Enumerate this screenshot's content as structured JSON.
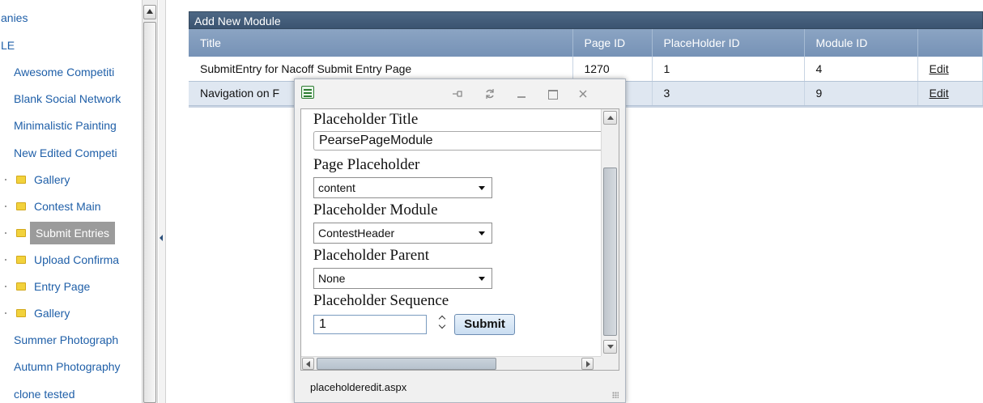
{
  "tree": {
    "items": [
      {
        "label": "anies",
        "indent": 0,
        "folder": false
      },
      {
        "label": "LE",
        "indent": 0,
        "folder": false
      },
      {
        "label": "Awesome Competiti",
        "indent": 1,
        "folder": false
      },
      {
        "label": "Blank Social Network",
        "indent": 1,
        "folder": false
      },
      {
        "label": "Minimalistic Painting",
        "indent": 1,
        "folder": false
      },
      {
        "label": "New Edited Competi",
        "indent": 1,
        "folder": false
      },
      {
        "label": "Gallery",
        "indent": 2,
        "folder": true
      },
      {
        "label": "Contest Main",
        "indent": 2,
        "folder": true
      },
      {
        "label": "Submit Entries",
        "indent": 2,
        "folder": true,
        "selected": true
      },
      {
        "label": "Upload Confirma",
        "indent": 2,
        "folder": true
      },
      {
        "label": "Entry Page",
        "indent": 2,
        "folder": true
      },
      {
        "label": "Gallery",
        "indent": 2,
        "folder": true
      },
      {
        "label": "Summer Photograph",
        "indent": 1,
        "folder": false
      },
      {
        "label": "Autumn Photography",
        "indent": 1,
        "folder": false
      },
      {
        "label": "clone tested",
        "indent": 1,
        "folder": false
      }
    ]
  },
  "grid": {
    "title": "Add New Module",
    "columns": [
      "Title",
      "Page ID",
      "PlaceHolder ID",
      "Module ID",
      ""
    ],
    "rows": [
      {
        "title": "SubmitEntry for Nacoff Submit Entry Page",
        "page_id": "1270",
        "placeholder_id": "1",
        "module_id": "4",
        "action": "Edit"
      },
      {
        "title": "Navigation on F",
        "page_id": "",
        "placeholder_id": "3",
        "module_id": "9",
        "action": "Edit"
      }
    ]
  },
  "dialog": {
    "titlebar_icons": [
      "pin-icon",
      "reload-icon",
      "minimize-icon",
      "maximize-icon",
      "close-icon"
    ],
    "form": {
      "placeholder_title_label": "Placeholder Title",
      "placeholder_title_value": "PearsePageModule",
      "page_placeholder_label": "Page Placeholder",
      "page_placeholder_value": "content",
      "placeholder_module_label": "Placeholder Module",
      "placeholder_module_value": "ContestHeader",
      "placeholder_parent_label": "Placeholder Parent",
      "placeholder_parent_value": "None",
      "placeholder_sequence_label": "Placeholder Sequence",
      "placeholder_sequence_value": "1",
      "submit_label": "Submit"
    },
    "status": "placeholderedit.aspx"
  },
  "colors": {
    "link": "#1f5fa8",
    "grid_header": "#3b5471",
    "grid_column_header": "#7692b6",
    "selected_tree_item": "#9b9b9b",
    "folder": "#f2d23c"
  }
}
